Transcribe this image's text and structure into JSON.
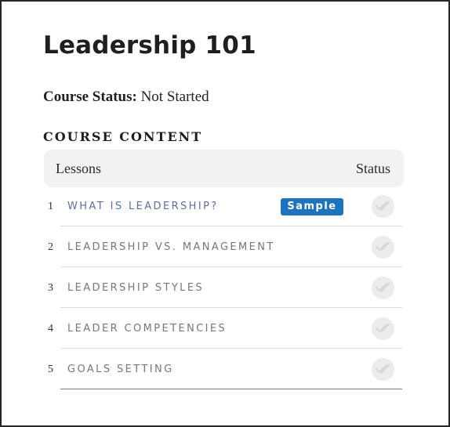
{
  "course": {
    "title": "Leadership 101",
    "status_label": "Course Status:",
    "status_value": "Not Started"
  },
  "content": {
    "heading": "COURSE CONTENT",
    "columns": {
      "lessons": "Lessons",
      "status": "Status"
    },
    "lessons": [
      {
        "number": "1",
        "title": "WHAT IS LEADERSHIP?",
        "badge": "Sample",
        "completed": false
      },
      {
        "number": "2",
        "title": "LEADERSHIP VS. MANAGEMENT",
        "completed": false
      },
      {
        "number": "3",
        "title": "LEADERSHIP STYLES",
        "completed": false
      },
      {
        "number": "4",
        "title": "LEADER COMPETENCIES",
        "completed": false
      },
      {
        "number": "5",
        "title": "GOALS SETTING",
        "completed": false
      }
    ]
  },
  "colors": {
    "badge_bg": "#1e73be",
    "link_title": "#5c6ea3",
    "muted_title": "#777777",
    "status_circle": "#ececec",
    "check_mark": "#d6d6d6"
  },
  "icons": {
    "status": "double-check-icon"
  }
}
